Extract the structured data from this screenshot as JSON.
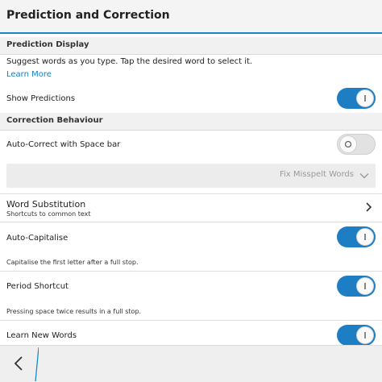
{
  "header": {
    "title": "Prediction and Correction"
  },
  "prediction_display": {
    "section_title": "Prediction Display",
    "description": "Suggest words as you type. Tap the desired word to select it.",
    "learn_more": "Learn More",
    "show_predictions": {
      "label": "Show Predictions",
      "state": "on"
    }
  },
  "correction_behaviour": {
    "section_title": "Correction Behaviour",
    "auto_correct": {
      "label": "Auto-Correct with Space bar",
      "state": "off"
    },
    "dropdown": {
      "value": "Fix Misspelt Words"
    }
  },
  "word_substitution": {
    "title": "Word Substitution",
    "subtitle": "Shortcuts to common text"
  },
  "auto_capitalise": {
    "label": "Auto-Capitalise",
    "state": "on",
    "description": "Capitalise the first letter after a full stop."
  },
  "period_shortcut": {
    "label": "Period Shortcut",
    "state": "on",
    "description": "Pressing space twice results in a full stop."
  },
  "learn_new_words": {
    "label": "Learn New Words",
    "state": "on"
  },
  "colors": {
    "accent": "#1e7ec4",
    "link": "#1a7fc1"
  }
}
